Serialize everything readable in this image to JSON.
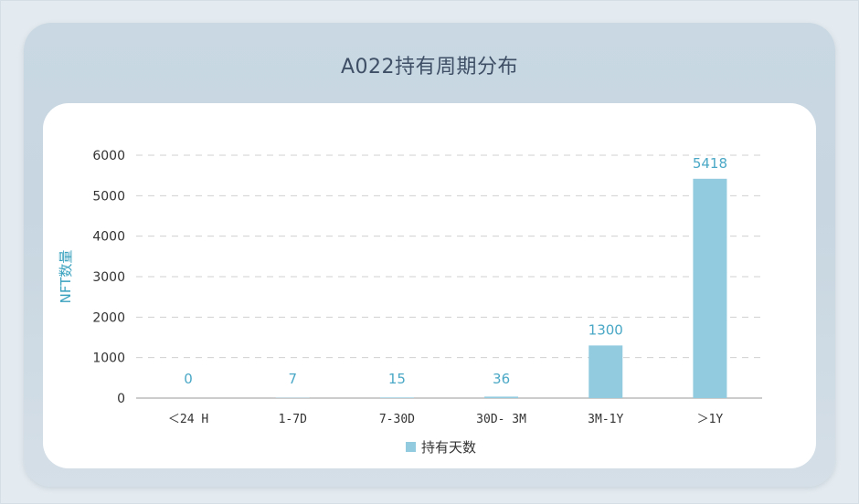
{
  "title": "A022持有周期分布",
  "chart_data": {
    "type": "bar",
    "title": "A022持有周期分布",
    "xlabel": "",
    "ylabel": "NFT数量",
    "categories": [
      "＜24 H",
      "1-7D",
      "7-30D",
      "30D- 3M",
      "3M-1Y",
      "＞1Y"
    ],
    "series": [
      {
        "name": "持有天数",
        "values": [
          0,
          7,
          15,
          36,
          1300,
          5418
        ]
      }
    ],
    "yticks": [
      0,
      1000,
      2000,
      3000,
      4000,
      5000,
      6000
    ],
    "ylim": [
      0,
      6000
    ],
    "grid": true,
    "legend": "bottom",
    "colors": {
      "bar": "#92cbdf",
      "label": "#4aa8c6",
      "grid": "#d0d0d0",
      "axis": "#999999"
    }
  }
}
